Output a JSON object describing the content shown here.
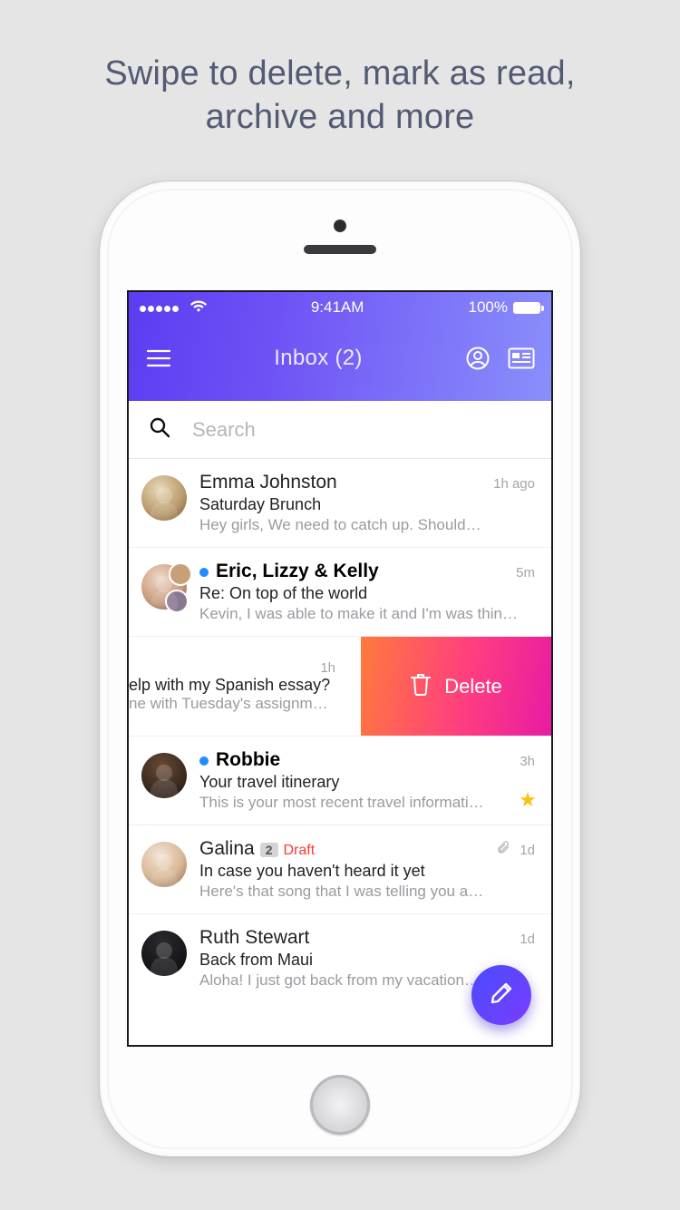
{
  "promo": "Swipe to delete, mark as read,\narchive and more",
  "status": {
    "time": "9:41AM",
    "battery": "100%"
  },
  "nav": {
    "title": "Inbox (2)"
  },
  "search": {
    "placeholder": "Search"
  },
  "swipe": {
    "delete_label": "Delete"
  },
  "swiped_row": {
    "time": "1h",
    "subject": "elp with my Spanish essay?",
    "preview": "ne with Tuesday's assignm…"
  },
  "fab": {
    "label": "Compose"
  },
  "emails": [
    {
      "sender": "Emma Johnston",
      "subject": "Saturday Brunch",
      "preview": "Hey girls, We need to catch up. Should…",
      "time": "1h ago",
      "unread": false
    },
    {
      "sender": "Eric, Lizzy & Kelly",
      "subject": "Re: On top of the world",
      "preview": "Kevin, I was able to make it and I'm was thin…",
      "time": "5m",
      "unread": true,
      "group": true
    },
    {
      "sender": "Robbie",
      "subject": "Your travel itinerary",
      "preview": "This is your most recent travel informati…",
      "time": "3h",
      "unread": true,
      "starred": true
    },
    {
      "sender": "Galina",
      "count": "2",
      "draft_label": "Draft",
      "subject": "In case you haven't heard it yet",
      "preview": "Here's that song that I was telling you a…",
      "time": "1d",
      "attachment": true
    },
    {
      "sender": "Ruth Stewart",
      "subject": "Back from Maui",
      "preview": "Aloha! I just got back from my vacation…",
      "time": "1d"
    }
  ]
}
